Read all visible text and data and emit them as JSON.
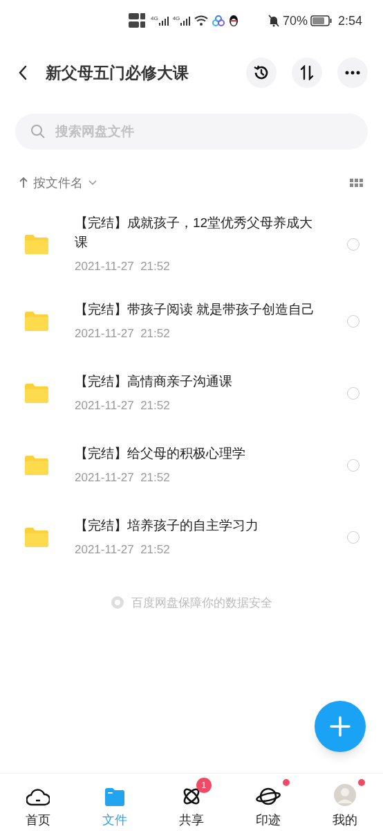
{
  "status_bar": {
    "network_labels": [
      "4G",
      "4G"
    ],
    "battery": "70%",
    "time": "2:54"
  },
  "header": {
    "title": "新父母五门必修大课"
  },
  "search": {
    "placeholder": "搜索网盘文件"
  },
  "sort": {
    "label": "按文件名"
  },
  "files": [
    {
      "name": "【完结】成就孩子，12堂优秀父母养成大课",
      "date": "2021-11-27  21:52",
      "selected": false
    },
    {
      "name": "【完结】带孩子阅读 就是带孩子创造自己",
      "date": "2021-11-27  21:52",
      "selected": false
    },
    {
      "name": "【完结】高情商亲子沟通课",
      "date": "2021-11-27  21:52",
      "selected": false
    },
    {
      "name": "【完结】给父母的积极心理学",
      "date": "2021-11-27  21:52",
      "selected": false
    },
    {
      "name": "【完结】培养孩子的自主学习力",
      "date": "2021-11-27  21:52",
      "selected": false
    }
  ],
  "footer_note": "百度网盘保障你的数据安全",
  "nav": [
    {
      "label": "首页",
      "kind": "home",
      "selected": false
    },
    {
      "label": "文件",
      "kind": "files",
      "selected": true
    },
    {
      "label": "共享",
      "kind": "share",
      "selected": false,
      "badge": "1"
    },
    {
      "label": "印迹",
      "kind": "planet",
      "selected": false,
      "dot": true
    },
    {
      "label": "我的",
      "kind": "avatar",
      "selected": false,
      "dot": true
    }
  ]
}
